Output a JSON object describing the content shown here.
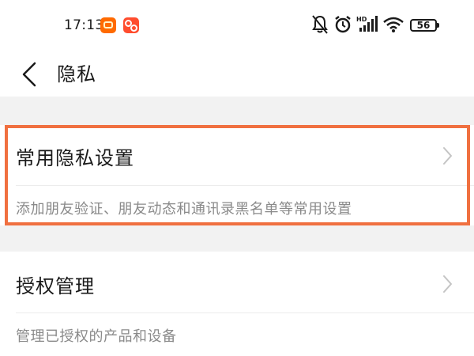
{
  "status_bar": {
    "time": "17:13",
    "battery_level": "56",
    "notification_apps": [
      "taobao-app-icon",
      "chat-app-icon"
    ],
    "indicators": [
      "mute-bell-icon",
      "alarm-icon",
      "hd-signal-icon",
      "wifi-icon",
      "battery-icon"
    ],
    "signal_label": "HD"
  },
  "header": {
    "title": "隐私",
    "back_icon": "chevron-left-icon"
  },
  "settings": [
    {
      "label": "常用隐私设置",
      "description": "添加朋友验证、朋友动态和通讯录黑名单等常用设置",
      "highlighted": true
    },
    {
      "label": "授权管理",
      "description": "管理已授权的产品和设备",
      "highlighted": false
    }
  ],
  "colors": {
    "highlight_border": "#f07040",
    "page_background": "#f2f2f2",
    "card_background": "#ffffff",
    "secondary_text": "#8a8a8a"
  }
}
